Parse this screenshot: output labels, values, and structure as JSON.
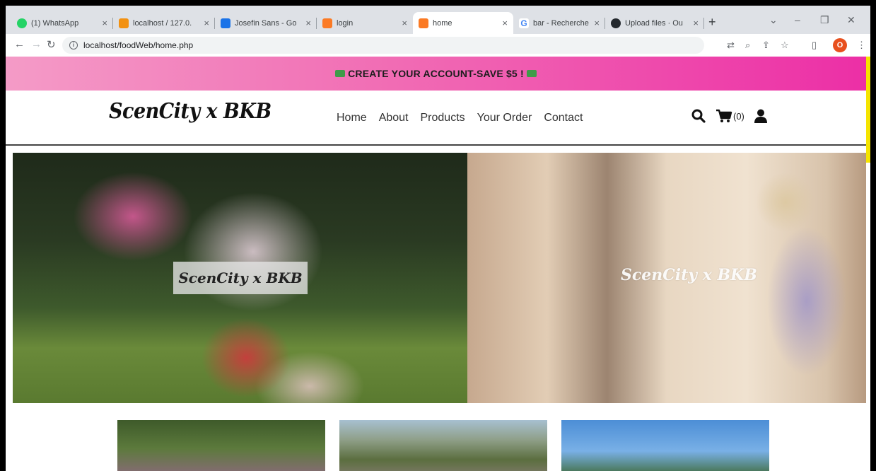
{
  "browser": {
    "tabs": [
      {
        "title": "(1) WhatsApp",
        "color": "#25d366",
        "glyph": "●"
      },
      {
        "title": "localhost / 127.0.",
        "color": "#f29111",
        "glyph": "▲"
      },
      {
        "title": "Josefin Sans - Go",
        "color": "#1a73e8",
        "glyph": "▮"
      },
      {
        "title": "login",
        "color": "#fb7a24",
        "glyph": "▣"
      },
      {
        "title": "home",
        "color": "#fb7a24",
        "glyph": "▣"
      },
      {
        "title": "bar - Recherche",
        "color": "#4285f4",
        "glyph": "G"
      },
      {
        "title": "Upload files · Ou",
        "color": "#24292e",
        "glyph": "●"
      }
    ],
    "url": "localhost/foodWeb/home.php",
    "profile_initial": "O"
  },
  "site": {
    "promo": "CREATE YOUR ACCOUNT-SAVE $5 !",
    "brand": "ScenCity x BKB",
    "menu": [
      "Home",
      "About",
      "Products",
      "Your Order",
      "Contact"
    ],
    "cart_count": "(0)",
    "hero_left_caption": "ScenCity x BKB",
    "hero_right_caption": "ScenCity x BKB"
  },
  "icons": {
    "search": "search-icon",
    "cart": "cart-icon",
    "user": "user-icon"
  },
  "colors": {
    "promo_start": "#f49bc7",
    "promo_end": "#ec2fa6",
    "scroll_indicator": "#f5e400",
    "profile": "#e8501e"
  }
}
